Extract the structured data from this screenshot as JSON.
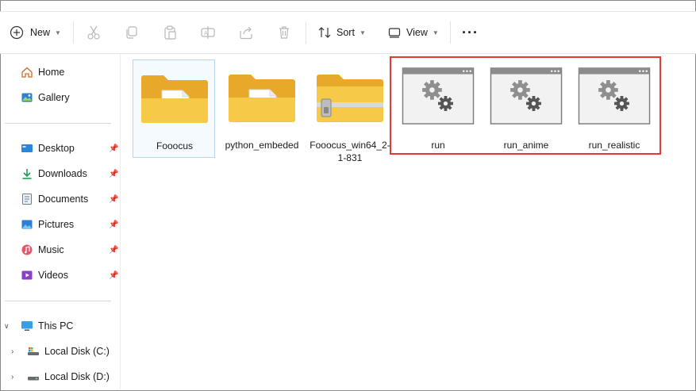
{
  "toolbar": {
    "new_label": "New",
    "sort_label": "Sort",
    "view_label": "View",
    "more_label": "···"
  },
  "sidebar": {
    "home": "Home",
    "gallery": "Gallery",
    "quick": [
      {
        "label": "Desktop",
        "icon": "desktop-icon"
      },
      {
        "label": "Downloads",
        "icon": "download-icon"
      },
      {
        "label": "Documents",
        "icon": "documents-icon"
      },
      {
        "label": "Pictures",
        "icon": "pictures-icon"
      },
      {
        "label": "Music",
        "icon": "music-icon"
      },
      {
        "label": "Videos",
        "icon": "videos-icon"
      }
    ],
    "this_pc": "This PC",
    "drives": [
      {
        "label": "Local Disk (C:)"
      },
      {
        "label": "Local Disk (D:)"
      }
    ]
  },
  "files": [
    {
      "name": "Fooocus",
      "type": "folder"
    },
    {
      "name": "python_embeded",
      "type": "folder"
    },
    {
      "name": "Fooocus_win64_2-1-831",
      "type": "zip"
    },
    {
      "name": "run",
      "type": "batch"
    },
    {
      "name": "run_anime",
      "type": "batch"
    },
    {
      "name": "run_realistic",
      "type": "batch"
    }
  ],
  "colors": {
    "highlight": "#e53935",
    "folder": "#f7c948",
    "accent": "#0067c0"
  }
}
